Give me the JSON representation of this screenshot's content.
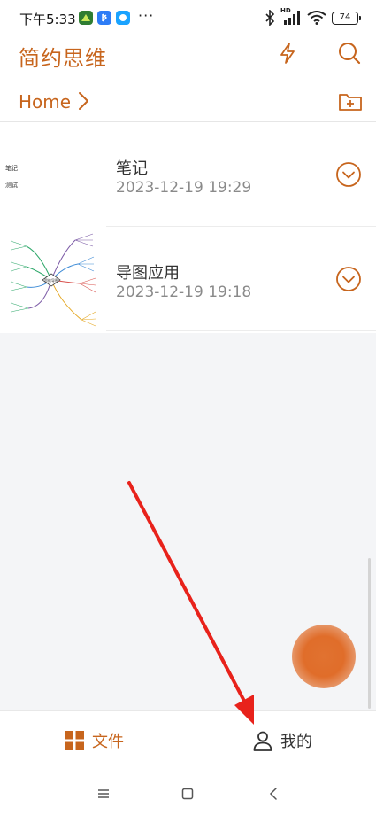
{
  "status_bar": {
    "time": "下午5:33",
    "battery": "74",
    "network": "HD",
    "overflow": "···"
  },
  "header": {
    "title": "简约思维",
    "icons": [
      "lightning-icon",
      "search-icon"
    ]
  },
  "breadcrumb": {
    "home": "Home",
    "icons": [
      "chevron-right-icon",
      "new-folder-icon"
    ]
  },
  "files": [
    {
      "name": "笔记",
      "date": "2023-12-19 19:29",
      "thumb_lines": [
        "笔记",
        "测试"
      ]
    },
    {
      "name": "导图应用",
      "date": "2023-12-19 19:18",
      "thumb_center": "思维导图"
    }
  ],
  "tabs": [
    {
      "label": "文件",
      "icon": "grid-icon",
      "color": "#c7651d",
      "selected": true
    },
    {
      "label": "我的",
      "icon": "person-icon",
      "color": "#333333",
      "selected": false
    }
  ],
  "colors": {
    "accent": "#c7651d",
    "annotation_arrow": "#e8221b"
  }
}
